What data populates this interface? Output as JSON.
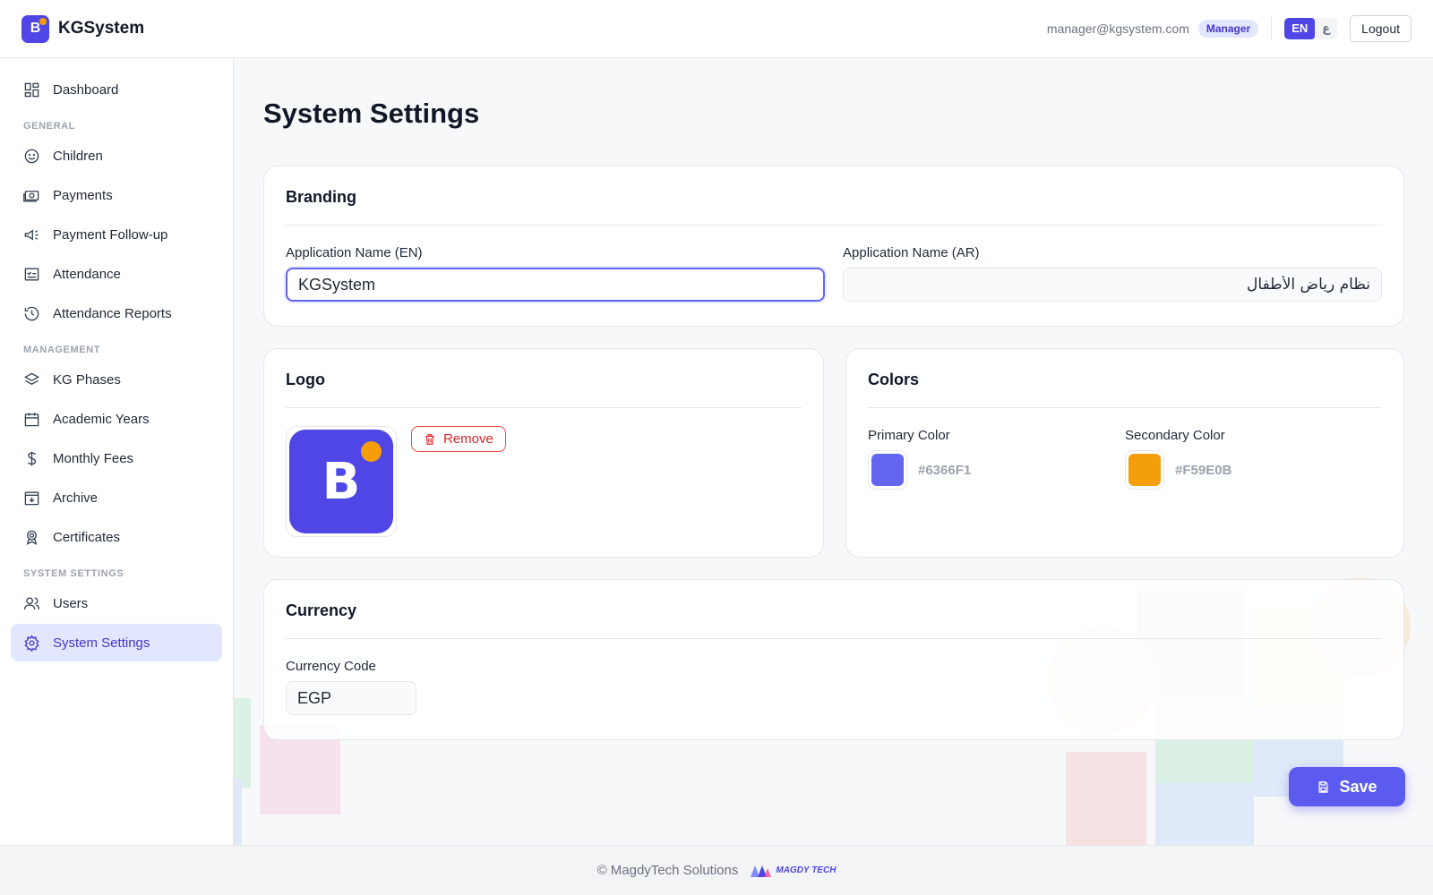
{
  "header": {
    "app_name": "KGSystem",
    "logo_letter": "B",
    "user_email": "manager@kgsystem.com",
    "role": "Manager",
    "lang_en": "EN",
    "lang_ar": "ع",
    "logout_label": "Logout"
  },
  "sidebar": {
    "dashboard": "Dashboard",
    "sections": {
      "general": "GENERAL",
      "management": "MANAGEMENT",
      "system": "SYSTEM SETTINGS"
    },
    "items": {
      "children": "Children",
      "payments": "Payments",
      "payment_followup": "Payment Follow-up",
      "attendance": "Attendance",
      "attendance_reports": "Attendance Reports",
      "kg_phases": "KG Phases",
      "academic_years": "Academic Years",
      "monthly_fees": "Monthly Fees",
      "archive": "Archive",
      "certificates": "Certificates",
      "users": "Users",
      "system_settings": "System Settings"
    },
    "active_item": "System Settings"
  },
  "page": {
    "title": "System Settings",
    "branding": {
      "title": "Branding",
      "name_en_label": "Application Name (EN)",
      "name_en_value": "KGSystem",
      "name_ar_label": "Application Name (AR)",
      "name_ar_value": "نظام رياض الأطفال"
    },
    "logo": {
      "title": "Logo",
      "letter": "B",
      "remove_label": "Remove"
    },
    "colors": {
      "title": "Colors",
      "primary_label": "Primary Color",
      "primary_hex": "#6366F1",
      "secondary_label": "Secondary Color",
      "secondary_hex": "#F59E0B"
    },
    "currency": {
      "title": "Currency",
      "code_label": "Currency Code",
      "code_value": "EGP"
    },
    "save_label": "Save"
  },
  "footer": {
    "text": "© MagdyTech Solutions",
    "logo_text": "MAGDY TECH"
  },
  "theme": {
    "accent": "#4F46E5",
    "accent_light": "#E0E7FF",
    "danger": "#DC2626"
  }
}
